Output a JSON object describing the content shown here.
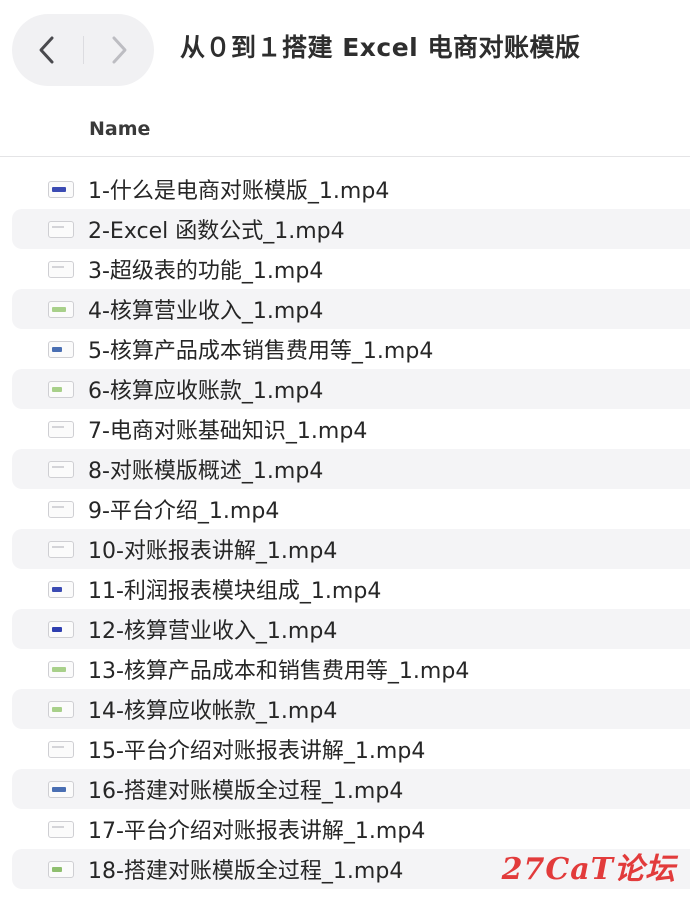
{
  "window": {
    "title": "从０到１搭建 Excel 电商对账模版"
  },
  "header": {
    "name_column": "Name"
  },
  "files": [
    {
      "name": "1-什么是电商对账模版_1.mp4",
      "thumb_color": "#3b4bb3"
    },
    {
      "name": "2-Excel 函数公式_1.mp4",
      "thumb_color": "#e0e0e4"
    },
    {
      "name": "3-超级表的功能_1.mp4",
      "thumb_color": "#e0e0e4"
    },
    {
      "name": "4-核算营业收入_1.mp4",
      "thumb_color": "#a8d08a"
    },
    {
      "name": "5-核算产品成本销售费用等_1.mp4",
      "thumb_color": "#4a6fb3"
    },
    {
      "name": "6-核算应收账款_1.mp4",
      "thumb_color": "#a8d08a"
    },
    {
      "name": "7-电商对账基础知识_1.mp4",
      "thumb_color": "#e0e0e4"
    },
    {
      "name": "8-对账模版概述_1.mp4",
      "thumb_color": "#d0d0d6"
    },
    {
      "name": "9-平台介绍_1.mp4",
      "thumb_color": "#e0e0e4"
    },
    {
      "name": "10-对账报表讲解_1.mp4",
      "thumb_color": "#e0e0e4"
    },
    {
      "name": "11-利润报表模块组成_1.mp4",
      "thumb_color": "#3b4bb3"
    },
    {
      "name": "12-核算营业收入_1.mp4",
      "thumb_color": "#2f3fb0"
    },
    {
      "name": "13-核算产品成本和销售费用等_1.mp4",
      "thumb_color": "#a8d08a"
    },
    {
      "name": "14-核算应收帐款_1.mp4",
      "thumb_color": "#a8d08a"
    },
    {
      "name": "15-平台介绍对账报表讲解_1.mp4",
      "thumb_color": "#e0e0e4"
    },
    {
      "name": "16-搭建对账模版全过程_1.mp4",
      "thumb_color": "#4a6fb3"
    },
    {
      "name": "17-平台介绍对账报表讲解_1.mp4",
      "thumb_color": "#d0d0d6"
    },
    {
      "name": "18-搭建对账模版全过程_1.mp4",
      "thumb_color": "#8fbf6f"
    }
  ],
  "watermark": {
    "text": "27CaT论坛"
  },
  "colors": {
    "alt_row": "#f4f4f6",
    "watermark": "#e23b3b"
  },
  "icons": {
    "back": "chevron-left-icon",
    "forward": "chevron-right-icon",
    "file": "video-thumbnail-icon"
  }
}
